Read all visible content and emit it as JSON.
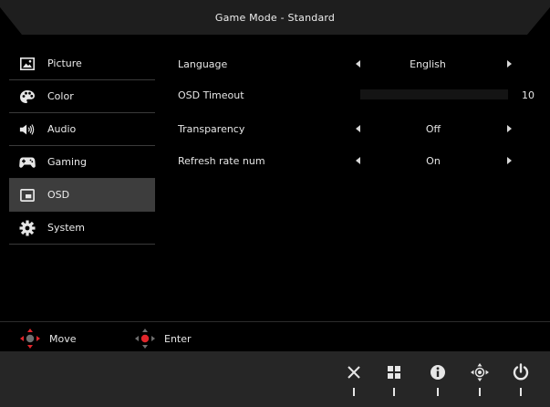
{
  "header": {
    "title": "Game Mode - Standard"
  },
  "sidebar": {
    "items": [
      {
        "label": "Picture",
        "icon": "picture-icon",
        "active": false
      },
      {
        "label": "Color",
        "icon": "palette-icon",
        "active": false
      },
      {
        "label": "Audio",
        "icon": "speaker-icon",
        "active": false
      },
      {
        "label": "Gaming",
        "icon": "gamepad-icon",
        "active": false
      },
      {
        "label": "OSD",
        "icon": "osd-icon",
        "active": true
      },
      {
        "label": "System",
        "icon": "gear-icon",
        "active": false
      }
    ]
  },
  "settings": {
    "language": {
      "label": "Language",
      "value": "English"
    },
    "osd_timeout": {
      "label": "OSD Timeout",
      "value": "10",
      "level": 0.0
    },
    "transparency": {
      "label": "Transparency",
      "value": "Off"
    },
    "refresh_rate_num": {
      "label": "Refresh rate num",
      "value": "On"
    }
  },
  "hints": {
    "move": {
      "label": "Move",
      "icon": "four-way-arrows-icon"
    },
    "enter": {
      "label": "Enter",
      "icon": "center-press-icon"
    }
  },
  "footer": {
    "buttons": [
      {
        "icon": "close-icon"
      },
      {
        "icon": "menu-grid-icon"
      },
      {
        "icon": "info-icon"
      },
      {
        "icon": "joystick-icon"
      },
      {
        "icon": "power-icon"
      }
    ]
  },
  "colors": {
    "background": "#000000",
    "active_item": "#3d3d3d",
    "footer": "#262626",
    "hint_accent": "#e0252a"
  }
}
